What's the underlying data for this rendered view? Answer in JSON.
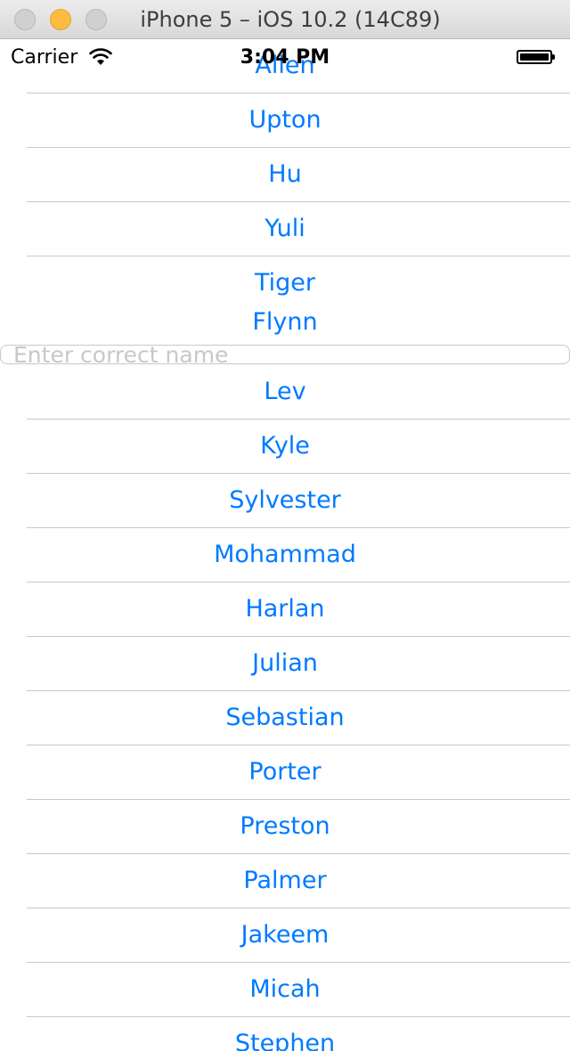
{
  "window": {
    "title": "iPhone 5 – iOS 10.2 (14C89)"
  },
  "statusbar": {
    "carrier": "Carrier",
    "time": "3:04 PM"
  },
  "input": {
    "placeholder": "Enter correct name",
    "value": ""
  },
  "names_top": [
    "Allen",
    "Upton",
    "Hu",
    "Yuli",
    "Tiger",
    "Flynn"
  ],
  "names_bottom": [
    "Lev",
    "Kyle",
    "Sylvester",
    "Mohammad",
    "Harlan",
    "Julian",
    "Sebastian",
    "Porter",
    "Preston",
    "Palmer",
    "Jakeem",
    "Micah",
    "Stephen"
  ],
  "colors": {
    "link": "#007aff",
    "separator": "#c8c7cc",
    "placeholder": "#c7c7cd"
  }
}
